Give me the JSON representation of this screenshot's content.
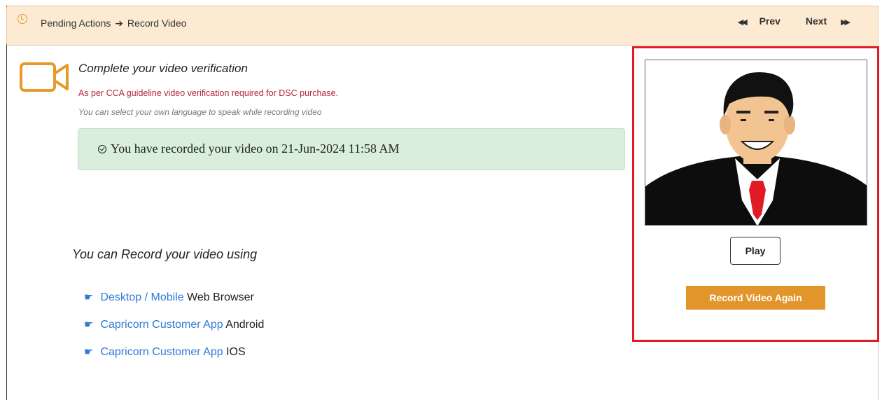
{
  "header": {
    "breadcrumb_parent": "Pending Actions",
    "breadcrumb_current": "Record Video",
    "prev_label": "Prev",
    "next_label": "Next"
  },
  "verification": {
    "title": "Complete your video verification",
    "guideline": "As per CCA guideline video verification required for DSC purchase.",
    "language_note": "You can select your own language to speak while recording video",
    "status": "You have recorded your video on 21-Jun-2024 11:58 AM"
  },
  "options": {
    "heading": "You can Record your video using",
    "items": [
      {
        "link": "Desktop / Mobile",
        "suffix": "Web Browser"
      },
      {
        "link": "Capricorn Customer App",
        "suffix": "Android"
      },
      {
        "link": "Capricorn Customer App",
        "suffix": "IOS"
      }
    ]
  },
  "video_panel": {
    "play_label": "Play",
    "record_again_label": "Record Video Again"
  },
  "colors": {
    "accent_orange": "#e2952a",
    "link_blue": "#2f7bd6",
    "success_bg": "#d9eedb",
    "highlight_red": "#e01b24"
  },
  "icons": {
    "breadcrumb": "clock-icon",
    "arrow": "arrow-right-icon",
    "prev": "double-left-icon",
    "next": "double-right-icon",
    "camera": "video-camera-icon",
    "check": "check-circle-icon",
    "option": "pointing-hand-icon"
  }
}
